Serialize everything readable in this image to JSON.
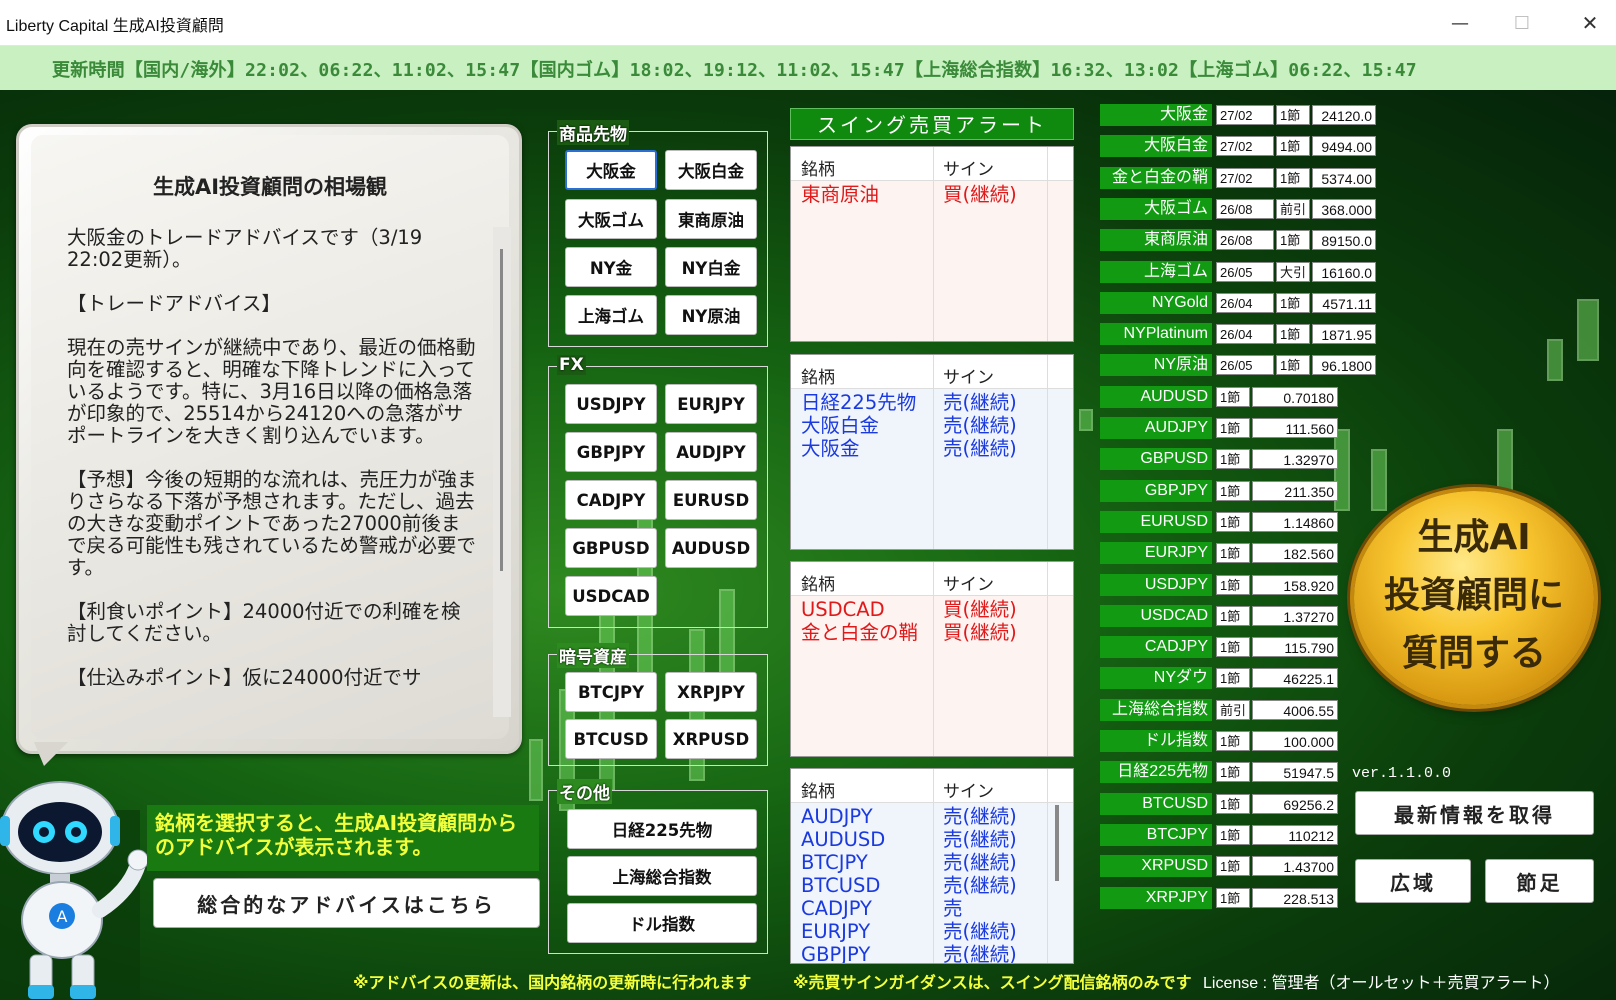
{
  "window": {
    "title": "Liberty Capital 生成AI投資顧問",
    "minimize": "—",
    "maximize": "☐",
    "close": "✕"
  },
  "ticker": {
    "text": "更新時間【国内/海外】22:02、06:22、11:02、15:47【国内ゴム】18:02、19:12、11:02、15:47【上海総合指数】16:32、13:02【上海ゴム】06:22、15:47"
  },
  "advice": {
    "title": "生成AI投資顧問の相場観",
    "body": "大阪金のトレードアドバイスです（3/19 22:02更新）。\n\n【トレードアドバイス】\n\n現在の売サインが継続中であり、最近の価格動向を確認すると、明確な下降トレンドに入っているようです。特に、3月16日以降の価格急落が印象的で、25514から24120への急落がサポートラインを大きく割り込んでいます。\n\n【予想】今後の短期的な流れは、売圧力が強まりさらなる下落が予想されます。ただし、過去の大きな変動ポイントであった27000前後まで戻る可能性も残されているため警戒が必要です。\n\n【利食いポイント】24000付近での利確を検討してください。\n\n【仕込みポイント】仮に24000付近でサ"
  },
  "hint": "銘柄を選択すると、生成AI投資顧問からのアドバイスが表示されます。",
  "overall_button": "総合的なアドバイスはこちら",
  "groups": {
    "commodities": {
      "title": "商品先物",
      "buttons": [
        "大阪金",
        "大阪白金",
        "大阪ゴム",
        "東商原油",
        "NY金",
        "NY白金",
        "上海ゴム",
        "NY原油"
      ]
    },
    "fx": {
      "title": "FX",
      "buttons": [
        "USDJPY",
        "EURJPY",
        "GBPJPY",
        "AUDJPY",
        "CADJPY",
        "EURUSD",
        "GBPUSD",
        "AUDUSD",
        "USDCAD"
      ]
    },
    "crypto": {
      "title": "暗号資産",
      "buttons": [
        "BTCJPY",
        "XRPJPY",
        "BTCUSD",
        "XRPUSD"
      ]
    },
    "other": {
      "title": "その他",
      "buttons": [
        "日経225先物",
        "上海総合指数",
        "ドル指数"
      ]
    }
  },
  "swing": {
    "header": "スイング売買アラート",
    "col_name": "銘柄",
    "col_sign": "サイン",
    "tables": [
      {
        "rows": [
          {
            "name": "東商原油",
            "sign": "買(継続)",
            "type": "buy"
          }
        ]
      },
      {
        "rows": [
          {
            "name": "日経225先物",
            "sign": "売(継続)",
            "type": "sell"
          },
          {
            "name": "大阪白金",
            "sign": "売(継続)",
            "type": "sell"
          },
          {
            "name": "大阪金",
            "sign": "売(継続)",
            "type": "sell"
          }
        ]
      },
      {
        "rows": [
          {
            "name": "USDCAD",
            "sign": "買(継続)",
            "type": "buy"
          },
          {
            "name": "金と白金の鞘",
            "sign": "買(継続)",
            "type": "buy"
          }
        ]
      },
      {
        "rows": [
          {
            "name": "AUDJPY",
            "sign": "売(継続)",
            "type": "sell"
          },
          {
            "name": "AUDUSD",
            "sign": "売(継続)",
            "type": "sell"
          },
          {
            "name": "BTCJPY",
            "sign": "売(継続)",
            "type": "sell"
          },
          {
            "name": "BTCUSD",
            "sign": "売(継続)",
            "type": "sell"
          },
          {
            "name": "CADJPY",
            "sign": "売",
            "type": "sell"
          },
          {
            "name": "EURJPY",
            "sign": "売(継続)",
            "type": "sell"
          },
          {
            "name": "GBPJPY",
            "sign": "売(継続)",
            "type": "sell"
          }
        ]
      }
    ]
  },
  "prices": [
    {
      "name": "大阪金",
      "month": "27/02",
      "node": "1節",
      "value": "24120.0"
    },
    {
      "name": "大阪白金",
      "month": "27/02",
      "node": "1節",
      "value": "9494.00"
    },
    {
      "name": "金と白金の鞘",
      "month": "27/02",
      "node": "1節",
      "value": "5374.00"
    },
    {
      "name": "大阪ゴム",
      "month": "26/08",
      "node": "前引",
      "value": "368.000"
    },
    {
      "name": "東商原油",
      "month": "26/08",
      "node": "1節",
      "value": "89150.0"
    },
    {
      "name": "上海ゴム",
      "month": "26/05",
      "node": "大引",
      "value": "16160.0"
    },
    {
      "name": "NYGold",
      "month": "26/04",
      "node": "1節",
      "value": "4571.11"
    },
    {
      "name": "NYPlatinum",
      "month": "26/04",
      "node": "1節",
      "value": "1871.95"
    },
    {
      "name": "NY原油",
      "month": "26/05",
      "node": "1節",
      "value": "96.1800"
    },
    {
      "name": "AUDUSD",
      "month": "",
      "node": "1節",
      "value": "0.70180"
    },
    {
      "name": "AUDJPY",
      "month": "",
      "node": "1節",
      "value": "111.560"
    },
    {
      "name": "GBPUSD",
      "month": "",
      "node": "1節",
      "value": "1.32970"
    },
    {
      "name": "GBPJPY",
      "month": "",
      "node": "1節",
      "value": "211.350"
    },
    {
      "name": "EURUSD",
      "month": "",
      "node": "1節",
      "value": "1.14860"
    },
    {
      "name": "EURJPY",
      "month": "",
      "node": "1節",
      "value": "182.560"
    },
    {
      "name": "USDJPY",
      "month": "",
      "node": "1節",
      "value": "158.920"
    },
    {
      "name": "USDCAD",
      "month": "",
      "node": "1節",
      "value": "1.37270"
    },
    {
      "name": "CADJPY",
      "month": "",
      "node": "1節",
      "value": "115.790"
    },
    {
      "name": "NYダウ",
      "month": "",
      "node": "1節",
      "value": "46225.1"
    },
    {
      "name": "上海総合指数",
      "month": "",
      "node": "前引",
      "value": "4006.55"
    },
    {
      "name": "ドル指数",
      "month": "",
      "node": "1節",
      "value": "100.000"
    },
    {
      "name": "日経225先物",
      "month": "",
      "node": "1節",
      "value": "51947.5"
    },
    {
      "name": "BTCUSD",
      "month": "",
      "node": "1節",
      "value": "69256.2"
    },
    {
      "name": "BTCJPY",
      "month": "",
      "node": "1節",
      "value": "110212"
    },
    {
      "name": "XRPUSD",
      "month": "",
      "node": "1節",
      "value": "1.43700"
    },
    {
      "name": "XRPJPY",
      "month": "",
      "node": "1節",
      "value": "228.513"
    }
  ],
  "ask_button": "生成AI\n投資顧問に\n質問する",
  "version": "ver.1.1.0.0",
  "actions": {
    "latest": "最新情報を取得",
    "wide": "広域",
    "node": "節足"
  },
  "footer": {
    "note1": "※アドバイスの更新は、国内銘柄の更新時に行われます",
    "note2": "※売買サインガイダンスは、スイング配信銘柄のみです",
    "license": "License : 管理者（オールセット＋売買アラート）"
  },
  "colors": {
    "accent_green": "#139a13",
    "buy_red": "#e01a1a",
    "sell_blue": "#1a3ae0",
    "hint_yellow": "#f4ff3c"
  }
}
